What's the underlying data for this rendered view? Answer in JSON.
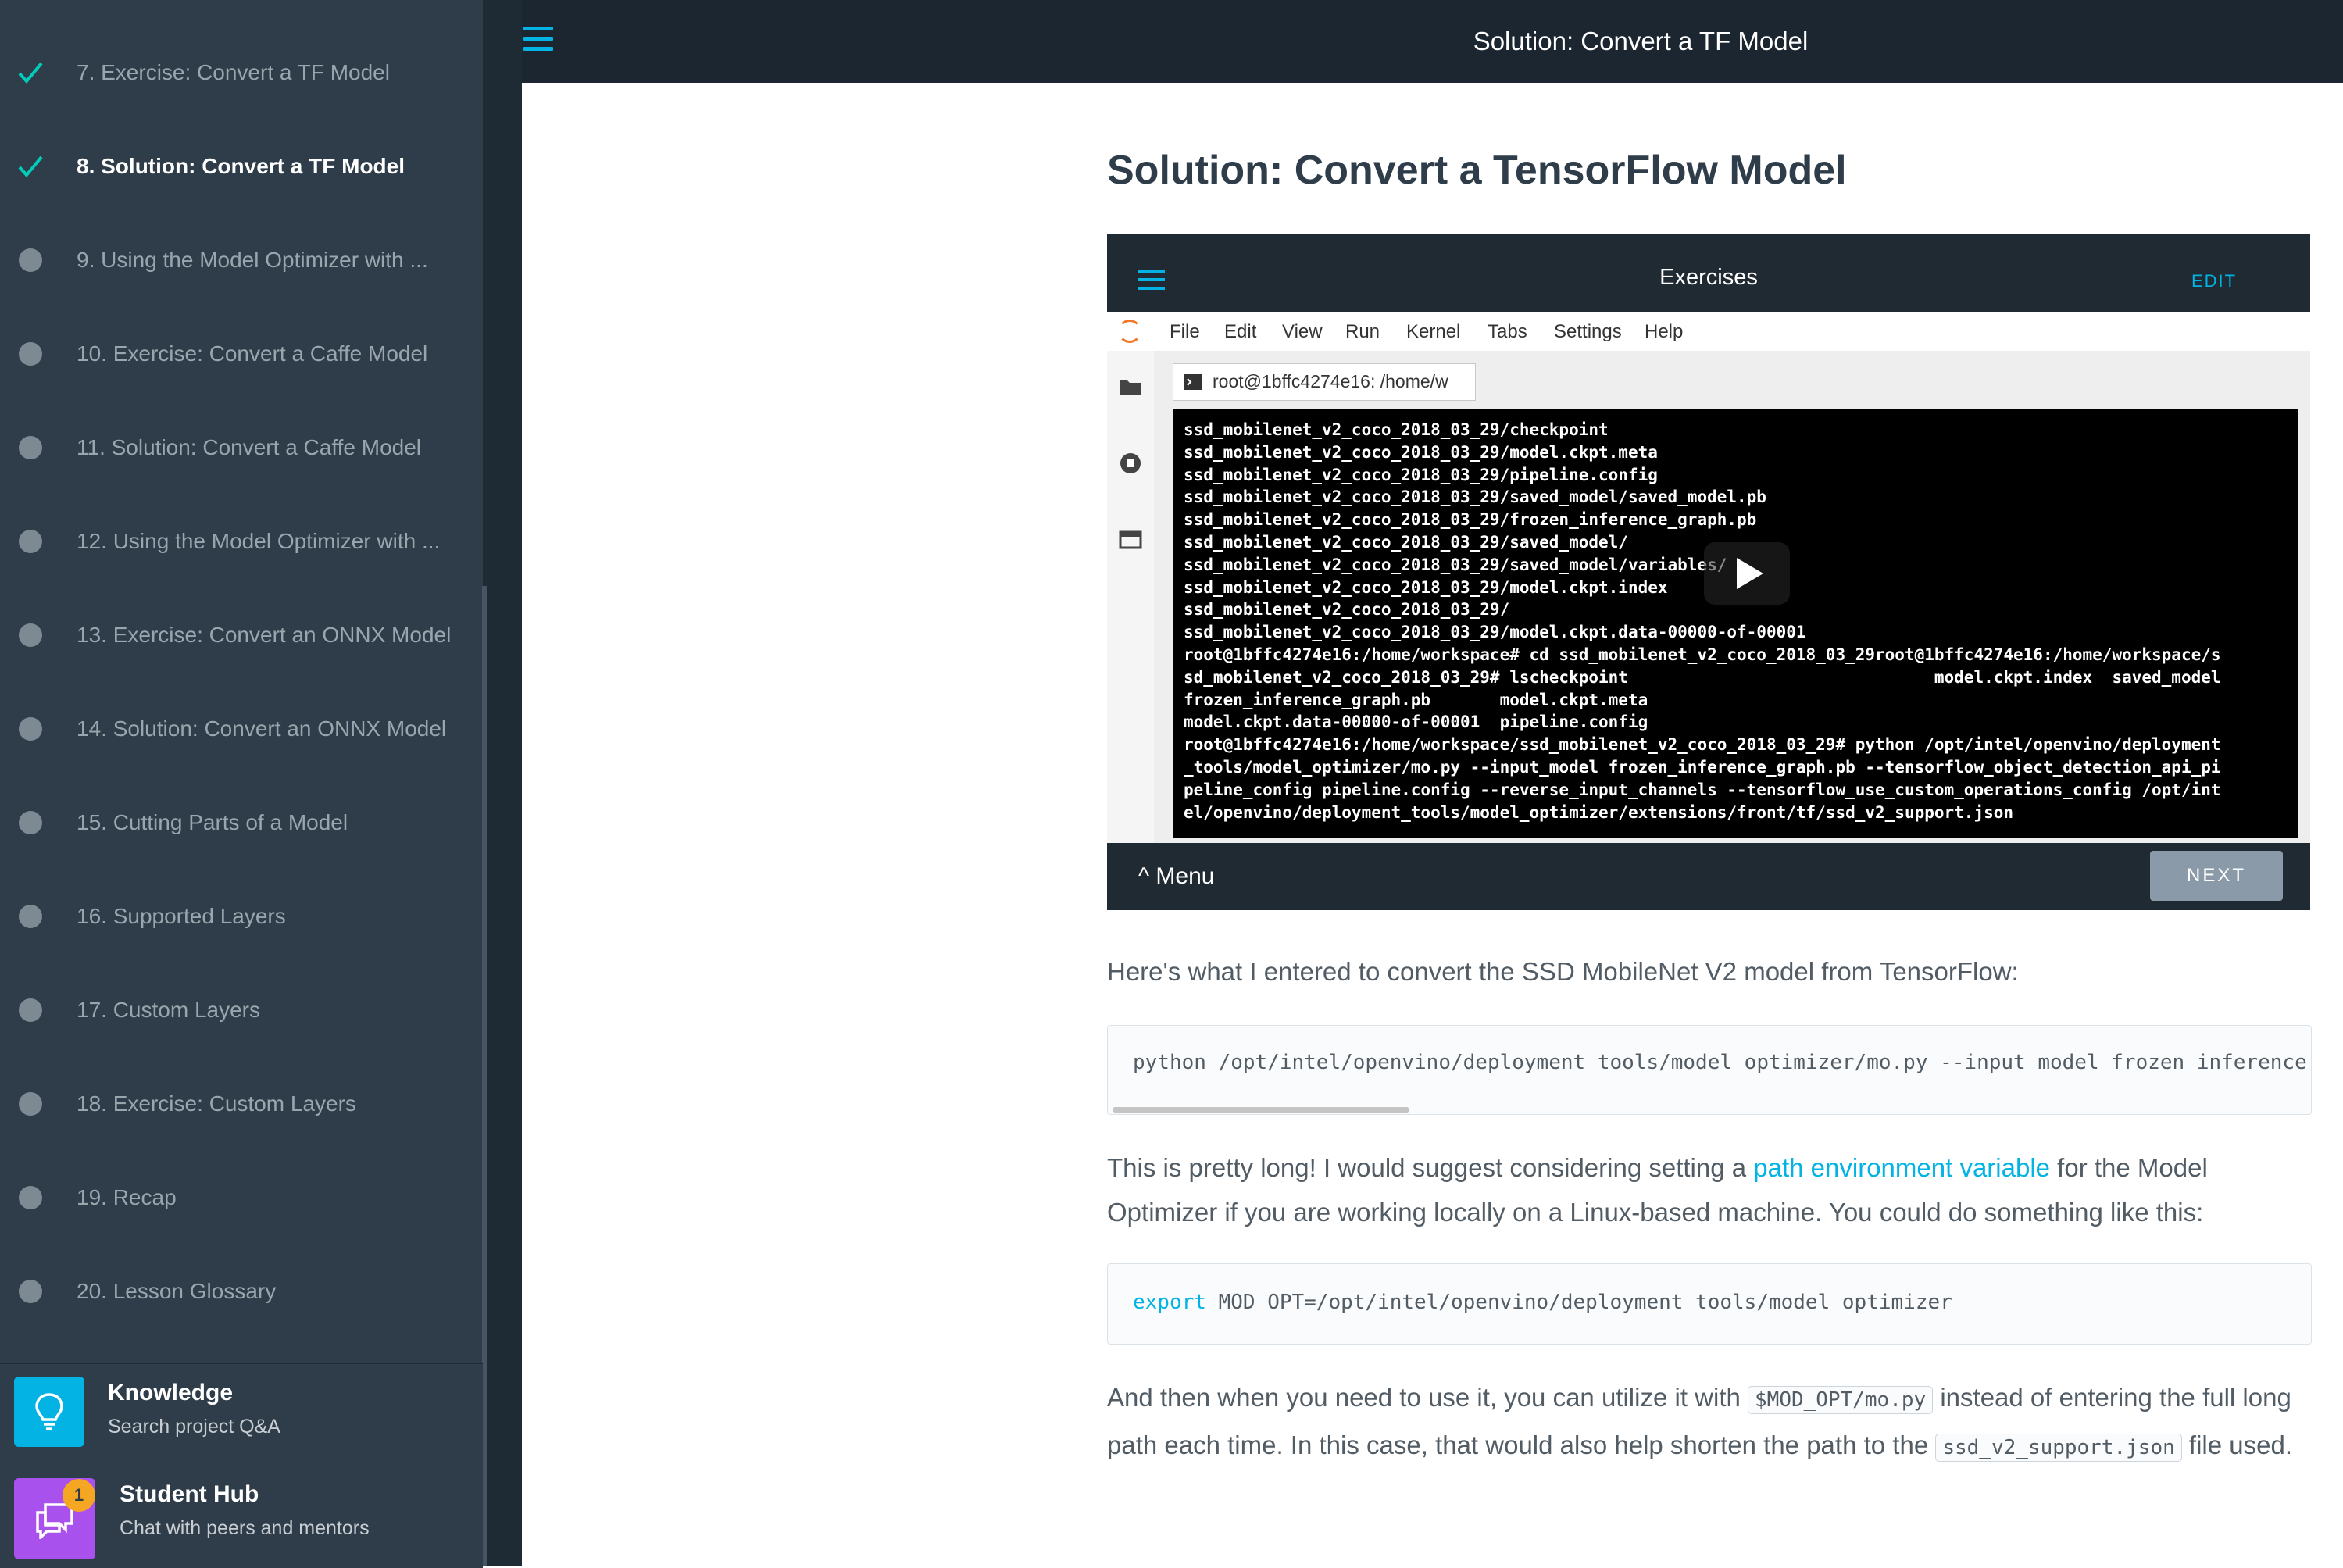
{
  "sidebar": {
    "items": [
      {
        "label": "7. Exercise: Convert a TF Model",
        "state": "done"
      },
      {
        "label": "8. Solution: Convert a TF Model",
        "state": "active"
      },
      {
        "label": "9. Using the Model Optimizer with ...",
        "state": "todo"
      },
      {
        "label": "10. Exercise: Convert a Caffe Model",
        "state": "todo"
      },
      {
        "label": "11. Solution: Convert a Caffe Model",
        "state": "todo"
      },
      {
        "label": "12. Using the Model Optimizer with ...",
        "state": "todo"
      },
      {
        "label": "13. Exercise: Convert an ONNX Model",
        "state": "todo"
      },
      {
        "label": "14. Solution: Convert an ONNX Model",
        "state": "todo"
      },
      {
        "label": "15. Cutting Parts of a Model",
        "state": "todo"
      },
      {
        "label": "16. Supported Layers",
        "state": "todo"
      },
      {
        "label": "17. Custom Layers",
        "state": "todo"
      },
      {
        "label": "18. Exercise: Custom Layers",
        "state": "todo"
      },
      {
        "label": "19. Recap",
        "state": "todo"
      },
      {
        "label": "20. Lesson Glossary",
        "state": "todo"
      }
    ],
    "knowledge": {
      "title": "Knowledge",
      "subtitle": "Search project Q&A",
      "icon": "lightbulb-icon"
    },
    "student_hub": {
      "title": "Student Hub",
      "subtitle": "Chat with peers and mentors",
      "icon": "chat-bubbles-icon",
      "badge": "1"
    }
  },
  "header": {
    "title": "Solution: Convert a TF Model"
  },
  "main": {
    "title": "Solution: Convert a TensorFlow Model",
    "video": {
      "app_title": "Exercises",
      "edit_label": "EDIT",
      "menus": [
        "File",
        "Edit",
        "View",
        "Run",
        "Kernel",
        "Tabs",
        "Settings",
        "Help"
      ],
      "tab_label": "root@1bffc4274e16: /home/w",
      "terminal_lines": [
        "ssd_mobilenet_v2_coco_2018_03_29/checkpoint",
        "ssd_mobilenet_v2_coco_2018_03_29/model.ckpt.meta",
        "ssd_mobilenet_v2_coco_2018_03_29/pipeline.config",
        "ssd_mobilenet_v2_coco_2018_03_29/saved_model/saved_model.pb",
        "ssd_mobilenet_v2_coco_2018_03_29/frozen_inference_graph.pb",
        "ssd_mobilenet_v2_coco_2018_03_29/saved_model/",
        "ssd_mobilenet_v2_coco_2018_03_29/saved_model/variables/",
        "ssd_mobilenet_v2_coco_2018_03_29/model.ckpt.index",
        "ssd_mobilenet_v2_coco_2018_03_29/",
        "ssd_mobilenet_v2_coco_2018_03_29/model.ckpt.data-00000-of-00001",
        "root@1bffc4274e16:/home/workspace# cd ssd_mobilenet_v2_coco_2018_03_29root@1bffc4274e16:/home/workspace/s",
        "sd_mobilenet_v2_coco_2018_03_29# lscheckpoint                               model.ckpt.index  saved_model",
        "frozen_inference_graph.pb       model.ckpt.meta",
        "model.ckpt.data-00000-of-00001  pipeline.config",
        "root@1bffc4274e16:/home/workspace/ssd_mobilenet_v2_coco_2018_03_29# python /opt/intel/openvino/deployment",
        "_tools/model_optimizer/mo.py --input_model frozen_inference_graph.pb --tensorflow_object_detection_api_pi",
        "peline_config pipeline.config --reverse_input_channels --tensorflow_use_custom_operations_config /opt/int",
        "el/openvino/deployment_tools/model_optimizer/extensions/front/tf/ssd_v2_support.json"
      ],
      "menu_label": "Menu",
      "next_label": "NEXT"
    },
    "para1": "Here's what I entered to convert the SSD MobileNet V2 model from TensorFlow:",
    "code1": "python /opt/intel/openvino/deployment_tools/model_optimizer/mo.py --input_model frozen_inference_",
    "para2_before": "This is pretty long! I would suggest considering setting a ",
    "para2_link": "path environment variable",
    "para2_after": " for the Model Optimizer if you are working locally on a Linux-based machine. You could do something like this:",
    "code2_kw": "export",
    "code2_rest": " MOD_OPT=/opt/intel/openvino/deployment_tools/model_optimizer",
    "para3_a": "And then when you need to use it, you can utilize it with ",
    "para3_code1": "$MOD_OPT/mo.py",
    "para3_b": " instead of entering the full long path each time. In this case, that would also help shorten the path to the ",
    "para3_code2": "ssd_v2_support.json",
    "para3_c": " file used."
  },
  "colors": {
    "accent": "#02b3e4",
    "sidebar_bg": "#2e3d49",
    "check": "#02ccba",
    "knowledge": "#02b3e4",
    "student_hub": "#a951ed"
  }
}
